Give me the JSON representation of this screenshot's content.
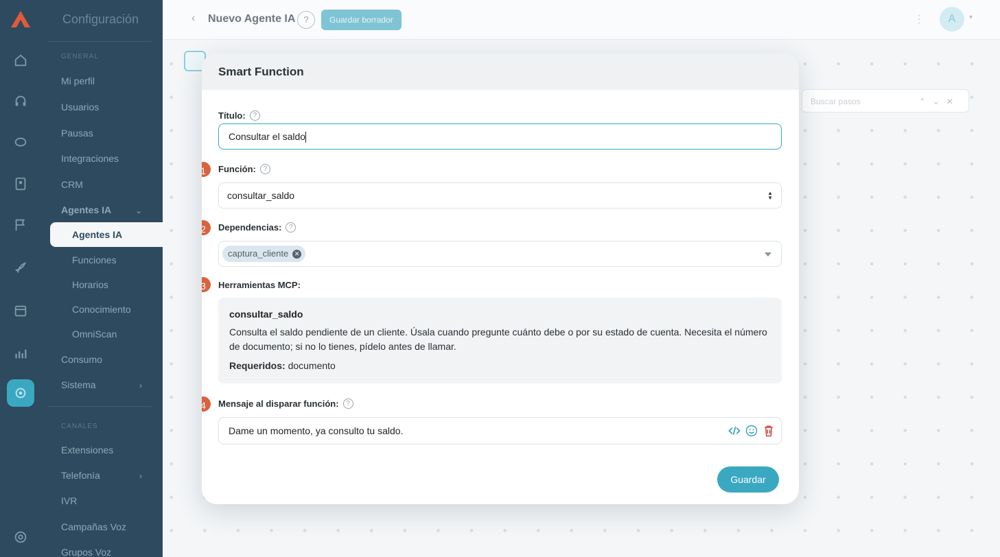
{
  "sidebar": {
    "title": "Configuración",
    "section_general": "GENERAL",
    "section_channels": "CANALES",
    "items": [
      {
        "label": "Mi perfil"
      },
      {
        "label": "Usuarios"
      },
      {
        "label": "Pausas"
      },
      {
        "label": "Integraciones"
      },
      {
        "label": "CRM"
      },
      {
        "label": "Agentes IA"
      }
    ],
    "subitems": [
      {
        "label": "Agentes IA"
      },
      {
        "label": "Funciones"
      },
      {
        "label": "Horarios"
      },
      {
        "label": "Conocimiento"
      },
      {
        "label": "OmniScan"
      }
    ],
    "items2": [
      {
        "label": "Consumo"
      },
      {
        "label": "Sistema"
      }
    ],
    "items3": [
      {
        "label": "Extensiones"
      },
      {
        "label": "Telefonía"
      },
      {
        "label": "IVR"
      },
      {
        "label": "Campañas Voz"
      },
      {
        "label": "Grupos Voz"
      }
    ]
  },
  "topbar": {
    "title": "Nuevo Agente IA",
    "help": "?",
    "draft_button": "Guardar borrador",
    "avatar": "A"
  },
  "canvas": {
    "search_placeholder": "Buscar pasos"
  },
  "modal": {
    "title": "Smart Function",
    "title_label": "Título:",
    "title_value": "Consultar el saldo",
    "function_label": "Función:",
    "function_value": "consultar_saldo",
    "dependencies_label": "Dependencias:",
    "dependency_tag": "captura_cliente",
    "mcp_label": "Herramientas MCP:",
    "mcp_name": "consultar_saldo",
    "mcp_description": "Consulta el saldo pendiente de un cliente. Úsala cuando pregunte cuánto debe o por su estado de cuenta. Necesita el número de documento; si no lo tienes, pídelo antes de llamar.",
    "mcp_required_label": "Requeridos:",
    "mcp_required_value": "documento",
    "message_label": "Mensaje al disparar función:",
    "message_value": "Dame un momento, ya consulto tu saldo.",
    "save_button": "Guardar",
    "steps": [
      "1",
      "2",
      "3",
      "4"
    ]
  },
  "colors": {
    "accent": "#3aa8c1",
    "badge": "#d9623f",
    "sidebar": "#2e4a5e",
    "delete": "#d0413b"
  }
}
